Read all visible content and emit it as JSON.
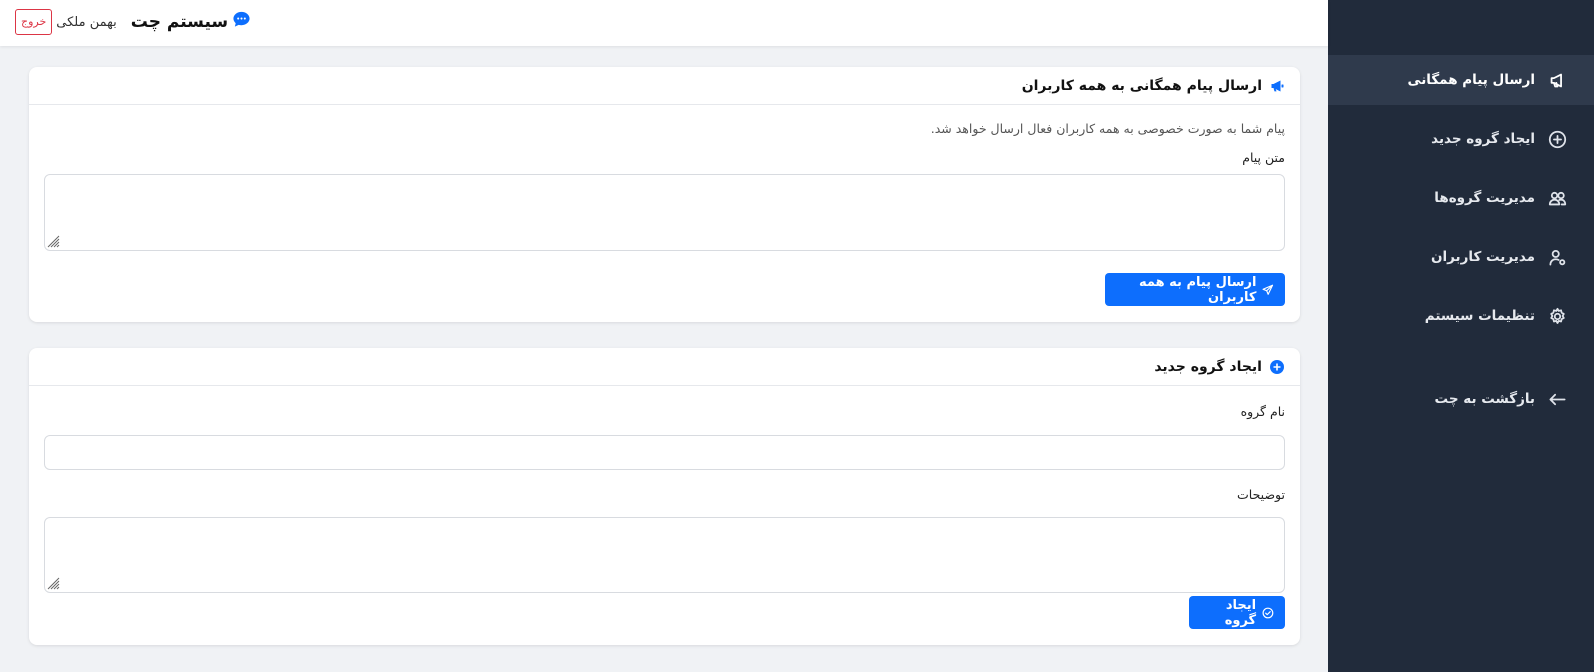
{
  "header": {
    "brand_title": "سیستم چت",
    "brand_icon": "chat-dots-icon",
    "username": "بهمن ملکی",
    "logout_label": "خروج"
  },
  "sidebar": {
    "items": [
      {
        "label": "ارسال پیام همگانی",
        "icon": "megaphone-icon",
        "active": true
      },
      {
        "label": "ایجاد گروه جدید",
        "icon": "plus-circle-icon",
        "active": false
      },
      {
        "label": "مدیریت گروه‌ها",
        "icon": "people-icon",
        "active": false
      },
      {
        "label": "مدیریت کاربران",
        "icon": "person-gear-icon",
        "active": false
      },
      {
        "label": "تنظیمات سیستم",
        "icon": "gear-icon",
        "active": false
      },
      {
        "label": "بازگشت به چت",
        "icon": "arrow-left-icon",
        "active": false
      }
    ]
  },
  "broadcast": {
    "title": "ارسال پیام همگانی به همه کاربران",
    "description": "پیام شما به صورت خصوصی به همه کاربران فعال ارسال خواهد شد.",
    "message_label": "متن پیام",
    "message_value": "",
    "submit_label": "ارسال پیام به همه کاربران"
  },
  "new_group": {
    "title": "ایجاد گروه جدید",
    "name_label": "نام گروه",
    "name_value": "",
    "description_label": "توضیحات",
    "description_value": "",
    "submit_label": "ایجاد گروه"
  },
  "colors": {
    "accent": "#0d6efd",
    "sidebar_bg": "#212b3b",
    "sidebar_active": "#2f3a4c",
    "danger": "#dc3545",
    "page_bg": "#f0f2f5"
  }
}
